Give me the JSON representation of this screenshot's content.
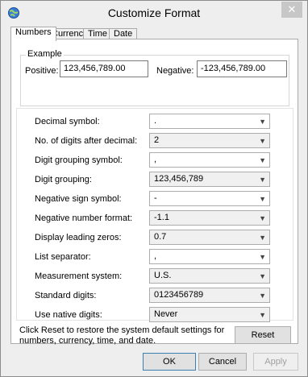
{
  "window": {
    "title": "Customize Format",
    "close_glyph": "✕",
    "icon": "region-settings-icon"
  },
  "tabs": [
    {
      "label": "Numbers",
      "active": true
    },
    {
      "label": "Currency",
      "active": false
    },
    {
      "label": "Time",
      "active": false
    },
    {
      "label": "Date",
      "active": false
    }
  ],
  "example": {
    "legend": "Example",
    "positive_label": "Positive:",
    "positive_value": "123,456,789.00",
    "negative_label": "Negative:",
    "negative_value": "-123,456,789.00"
  },
  "settings": [
    {
      "label": "Decimal symbol:",
      "value": "."
    },
    {
      "label": "No. of digits after decimal:",
      "value": "2"
    },
    {
      "label": "Digit grouping symbol:",
      "value": ","
    },
    {
      "label": "Digit grouping:",
      "value": "123,456,789"
    },
    {
      "label": "Negative sign symbol:",
      "value": "-"
    },
    {
      "label": "Negative number format:",
      "value": "-1.1"
    },
    {
      "label": "Display leading zeros:",
      "value": "0.7"
    },
    {
      "label": "List separator:",
      "value": ","
    },
    {
      "label": "Measurement system:",
      "value": "U.S."
    },
    {
      "label": "Standard digits:",
      "value": "0123456789"
    },
    {
      "label": "Use native digits:",
      "value": "Never"
    }
  ],
  "info_text": "Click Reset to restore the system default settings for numbers, currency, time, and date.",
  "buttons": {
    "reset": "Reset",
    "ok": "OK",
    "cancel": "Cancel",
    "apply": "Apply"
  },
  "colors": {
    "chrome": "#eeeeee",
    "panel": "#ffffff",
    "default_button_border": "#3c7fb1"
  }
}
